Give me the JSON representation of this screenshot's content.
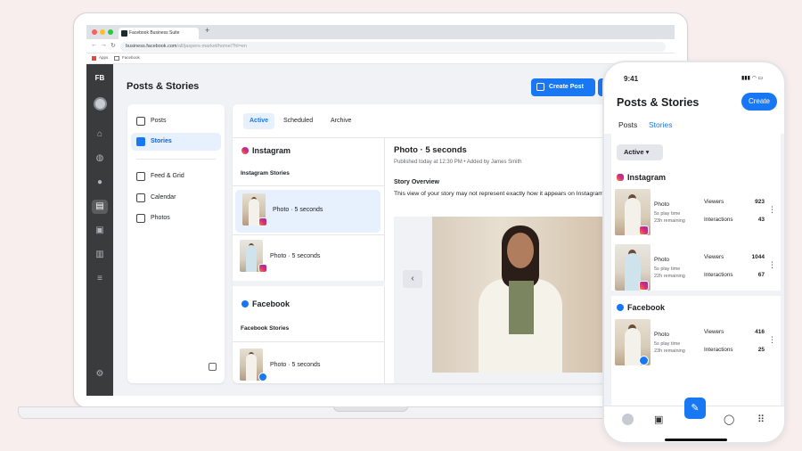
{
  "browser": {
    "tab_title": "Facebook Business Suite",
    "new_tab": "+",
    "url_host": "business.facebook.com",
    "url_path": "/all/jaspers-market/home/?hl=en",
    "bookmarks": [
      "Apps",
      "Facebook"
    ]
  },
  "rail": {
    "logo": "FB"
  },
  "page": {
    "title": "Posts & Stories",
    "create_post": "Create Post"
  },
  "sidebar": {
    "items": [
      {
        "label": "Posts",
        "icon": "posts-icon"
      },
      {
        "label": "Stories",
        "icon": "stories-icon"
      },
      {
        "label": "Feed & Grid",
        "icon": "grid-icon"
      },
      {
        "label": "Calendar",
        "icon": "calendar-icon"
      },
      {
        "label": "Photos",
        "icon": "photos-icon"
      }
    ]
  },
  "panel": {
    "tabs": [
      "Active",
      "Scheduled",
      "Archive"
    ],
    "instagram": {
      "title": "Instagram",
      "subtitle": "Instagram Stories",
      "rows": [
        "Photo · 5 seconds",
        "Photo · 5 seconds"
      ]
    },
    "facebook": {
      "title": "Facebook",
      "subtitle": "Facebook Stories",
      "rows": [
        "Photo · 5 seconds"
      ]
    },
    "preview": {
      "title": "Photo · 5 seconds",
      "meta": "Published today at 12:30 PM • Added by James Smith",
      "overview": "Story Overview",
      "desc": "This view of your story may not represent exactly how it appears on Instagram Feed.",
      "prev_arrow": "‹"
    }
  },
  "phone": {
    "time": "9:41",
    "title": "Posts & Stories",
    "create": "Create",
    "tabs": [
      "Posts",
      "Stories"
    ],
    "filter": "Active",
    "instagram_title": "Instagram",
    "facebook_title": "Facebook",
    "viewers_label": "Viewers",
    "interactions_label": "Interactions",
    "ig_rows": [
      {
        "label": "Photo",
        "play": "5s play time",
        "remaining": "23h remaining",
        "viewers": "923",
        "interactions": "43"
      },
      {
        "label": "Photo",
        "play": "5s play time",
        "remaining": "22h remaining",
        "viewers": "1044",
        "interactions": "67"
      }
    ],
    "fb_rows": [
      {
        "label": "Photo",
        "play": "5s play time",
        "remaining": "23h remaining",
        "viewers": "416",
        "interactions": "25"
      }
    ]
  },
  "colors": {
    "accent": "#1877f2",
    "rail": "#3a3b3c",
    "selected_bg": "#e7f0fd",
    "background": "#f7eeed"
  }
}
